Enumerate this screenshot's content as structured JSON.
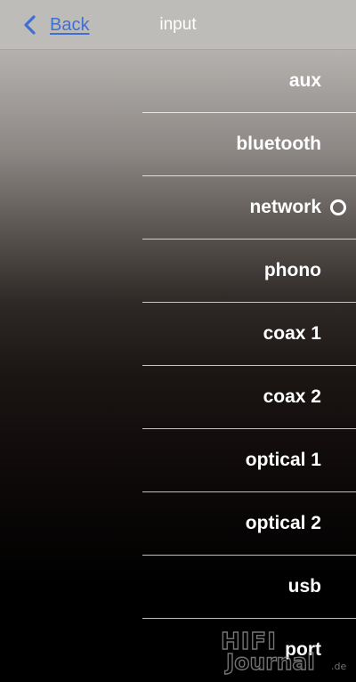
{
  "header": {
    "back_label": "Back",
    "title": "input"
  },
  "inputs": [
    {
      "label": "aux",
      "selected": false
    },
    {
      "label": "bluetooth",
      "selected": false
    },
    {
      "label": "network",
      "selected": true
    },
    {
      "label": "phono",
      "selected": false
    },
    {
      "label": "coax 1",
      "selected": false
    },
    {
      "label": "coax 2",
      "selected": false
    },
    {
      "label": "optical 1",
      "selected": false
    },
    {
      "label": "optical 2",
      "selected": false
    },
    {
      "label": "usb",
      "selected": false
    },
    {
      "label": "port",
      "selected": false
    }
  ],
  "watermark": {
    "line1": "HIFI",
    "line2": "Journal",
    "suffix": ".de"
  },
  "colors": {
    "accent": "#3f6fd2",
    "header_bg": "#bebcb9",
    "text": "#ffffff"
  },
  "icons": {
    "back": "chevron-left-icon",
    "selected": "radio-ring-icon"
  }
}
